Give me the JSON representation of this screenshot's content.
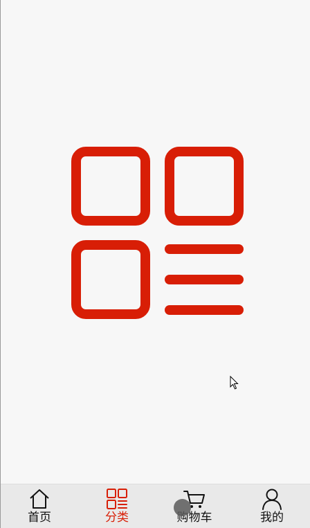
{
  "hero": {
    "icon": "category-grid-icon",
    "color": "#d81e06"
  },
  "tabbar": {
    "active_color": "#d81e06",
    "inactive_color": "#111111",
    "items": [
      {
        "label": "首页",
        "icon": "home-icon",
        "active": false
      },
      {
        "label": "分类",
        "icon": "category-icon",
        "active": true
      },
      {
        "label": "购物车",
        "icon": "cart-icon",
        "active": false
      },
      {
        "label": "我的",
        "icon": "user-icon",
        "active": false
      }
    ]
  }
}
